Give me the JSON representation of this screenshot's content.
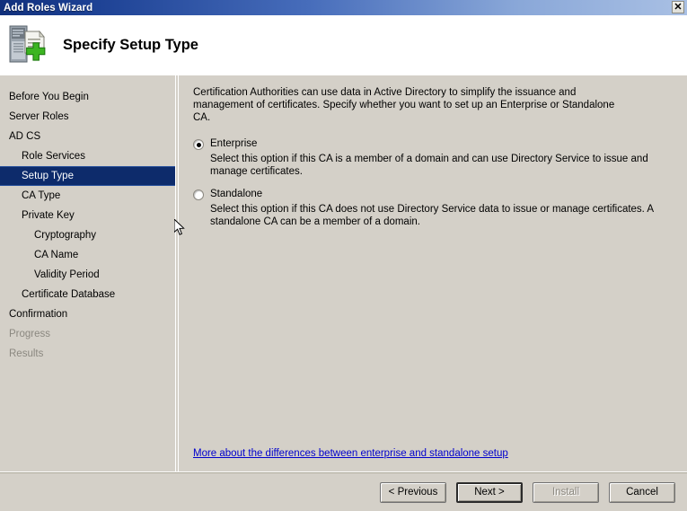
{
  "window": {
    "title": "Add Roles Wizard",
    "close_label": "✕"
  },
  "header": {
    "title": "Specify Setup Type",
    "icon": "server-certificate-add-icon"
  },
  "sidebar": {
    "items": [
      {
        "label": "Before You Begin",
        "indent": 0,
        "state": "normal"
      },
      {
        "label": "Server Roles",
        "indent": 0,
        "state": "normal"
      },
      {
        "label": "AD CS",
        "indent": 0,
        "state": "normal"
      },
      {
        "label": "Role Services",
        "indent": 1,
        "state": "normal"
      },
      {
        "label": "Setup Type",
        "indent": 1,
        "state": "selected"
      },
      {
        "label": "CA Type",
        "indent": 1,
        "state": "normal"
      },
      {
        "label": "Private Key",
        "indent": 1,
        "state": "normal"
      },
      {
        "label": "Cryptography",
        "indent": 2,
        "state": "normal"
      },
      {
        "label": "CA Name",
        "indent": 2,
        "state": "normal"
      },
      {
        "label": "Validity Period",
        "indent": 2,
        "state": "normal"
      },
      {
        "label": "Certificate Database",
        "indent": 1,
        "state": "normal"
      },
      {
        "label": "Confirmation",
        "indent": 0,
        "state": "normal"
      },
      {
        "label": "Progress",
        "indent": 0,
        "state": "disabled"
      },
      {
        "label": "Results",
        "indent": 0,
        "state": "disabled"
      }
    ]
  },
  "content": {
    "intro": "Certification Authorities can use data in Active Directory to simplify the issuance and management of certificates. Specify whether you want to set up an Enterprise or Standalone CA.",
    "options": [
      {
        "label": "Enterprise",
        "description": "Select this option if this CA is a member of a domain and can use Directory Service to issue and manage certificates.",
        "selected": true
      },
      {
        "label": "Standalone",
        "description": "Select this option if this CA does not use Directory Service data to issue or manage certificates. A standalone CA can be a member of a domain.",
        "selected": false
      }
    ],
    "more_link": "More about the differences between enterprise and standalone setup"
  },
  "footer": {
    "buttons": [
      {
        "label": "< Previous",
        "state": "normal"
      },
      {
        "label": "Next >",
        "state": "default"
      },
      {
        "label": "Install",
        "state": "disabled"
      },
      {
        "label": "Cancel",
        "state": "normal"
      }
    ]
  },
  "colors": {
    "title_bar_start": "#11307c",
    "title_bar_end": "#a9c0e4",
    "selection": "#0d2b6b",
    "window_face": "#d4d0c8",
    "link": "#0000cd",
    "disabled_text": "#8b8880"
  }
}
